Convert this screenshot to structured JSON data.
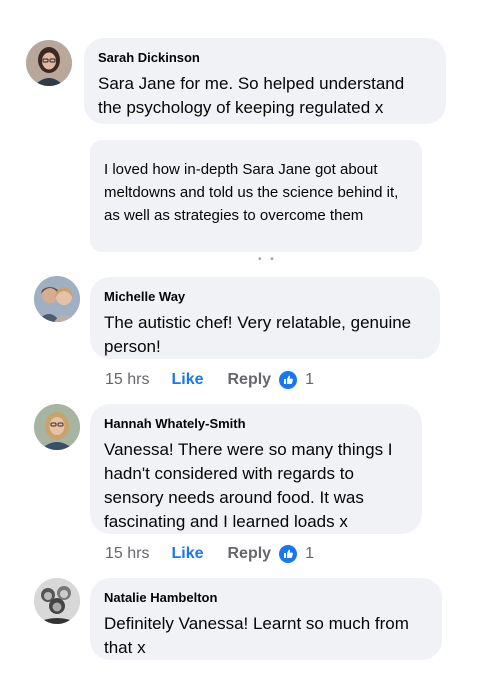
{
  "comments": [
    {
      "author": "Sarah Dickinson",
      "text": "Sara Jane for me. So helped understand the psychology of keeping regulated x",
      "avatar_icon": "profile-photo",
      "quote": "I loved how in-depth Sara Jane  got about meltdowns and told us the science behind it, as well as strategies to overcome them"
    },
    {
      "author": "Michelle Way",
      "text": "The autistic chef! Very relatable, genuine person!",
      "avatar_icon": "profile-photo",
      "time": "15 hrs",
      "like_label": "Like",
      "reply_label": "Reply",
      "reaction_icon": "thumbs-up-icon",
      "reaction_count": "1"
    },
    {
      "author": "Hannah Whately-Smith",
      "text": "Vanessa! There were so many things I hadn't considered with regards to sensory needs around food. It was fascinating and I learned loads x",
      "avatar_icon": "profile-photo",
      "time": "15 hrs",
      "like_label": "Like",
      "reply_label": "Reply",
      "reaction_icon": "thumbs-up-icon",
      "reaction_count": "1"
    },
    {
      "author": "Natalie Hambelton",
      "text": "Definitely Vanessa! Learnt so much from that x",
      "avatar_icon": "profile-photo"
    }
  ],
  "colors": {
    "like_blue": "#1877f2",
    "bubble_bg": "#f0f2f5",
    "meta_gray": "#65676b"
  }
}
